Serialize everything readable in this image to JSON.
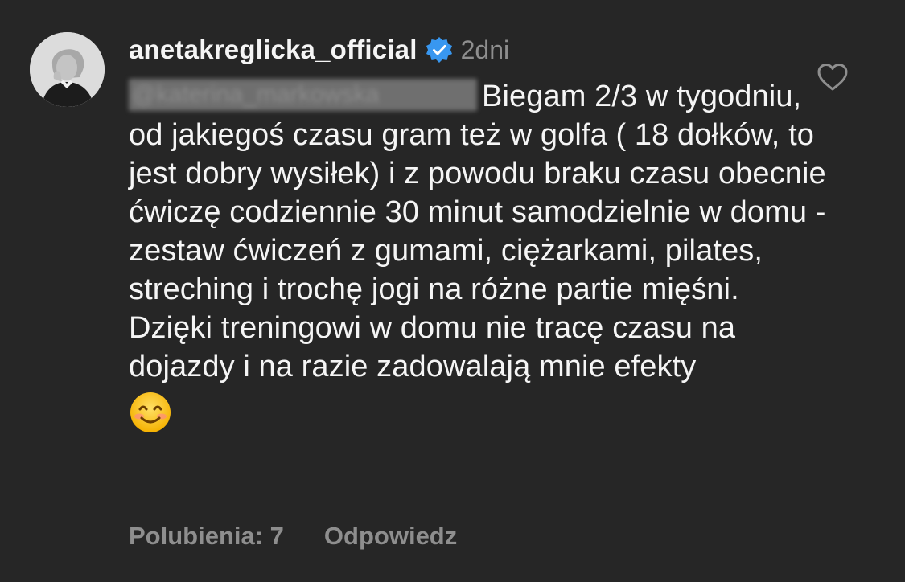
{
  "comment": {
    "username": "anetakreglicka_official",
    "verified_icon": "verified-badge-icon",
    "time": "2dni",
    "mention": "@katerina_markowska",
    "text": "Biegam 2/3 w tygodniu, od jakiegoś czasu gram też w golfa ( 18 dołków, to jest dobry wysiłek) i z powodu braku czasu obecnie ćwiczę codziennie 30 minut samodzielnie w domu - zestaw ćwiczeń z gumami, ciężarkami, pilates, streching i trochę jogi na różne partie mięśni. Dzięki treningowi w domu nie tracę czasu na dojazdy i na razie zadowalają mnie efekty",
    "emoji": "smiling-face-emoji",
    "likes_label": "Polubienia: 7",
    "reply_label": "Odpowiedz"
  },
  "colors": {
    "background": "#262626",
    "text": "#f5f5f5",
    "secondary_text": "#8e8e8e",
    "verified_blue": "#3897f0"
  }
}
